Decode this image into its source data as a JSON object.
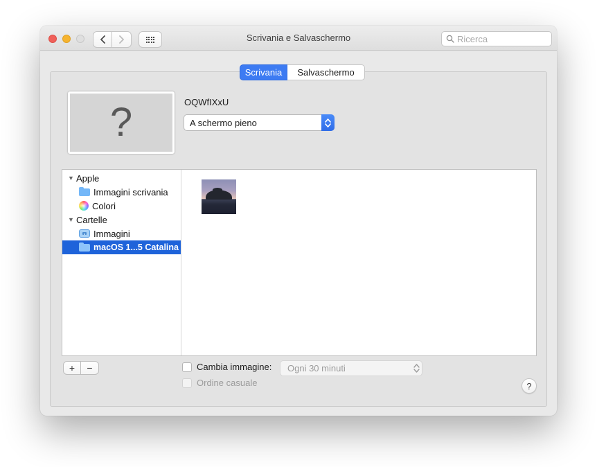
{
  "window": {
    "title": "Scrivania e Salvaschermo"
  },
  "titlebar": {
    "search_placeholder": "Ricerca"
  },
  "tabs": {
    "desktop": "Scrivania",
    "screensaver": "Salvaschermo"
  },
  "preview": {
    "placeholder_glyph": "?",
    "wallpaper_name": "OQWfIXxU",
    "fit_dropdown_value": "A schermo pieno"
  },
  "sidebar": {
    "groups": [
      {
        "label": "Apple",
        "items": [
          {
            "label": "Immagini scrivania",
            "icon": "folder-icon"
          },
          {
            "label": "Colori",
            "icon": "color-wheel-icon"
          }
        ]
      },
      {
        "label": "Cartelle",
        "items": [
          {
            "label": "Immagini",
            "icon": "photos-icon"
          },
          {
            "label": "macOS 1...5 Catalina",
            "icon": "folder-icon",
            "selected": true
          }
        ]
      }
    ]
  },
  "footer": {
    "add_label": "+",
    "remove_label": "−",
    "change_image_label": "Cambia immagine:",
    "interval_dropdown_value": "Ogni 30 minuti",
    "random_order_label": "Ordine casuale",
    "help_label": "?"
  },
  "colors": {
    "tab_active_blue": "#3d7bf2",
    "sidebar_selection_blue": "#1e63da",
    "stepper_blue": "#3a7bf0",
    "traffic_red": "#f0605a",
    "traffic_yellow": "#f6b42f"
  }
}
